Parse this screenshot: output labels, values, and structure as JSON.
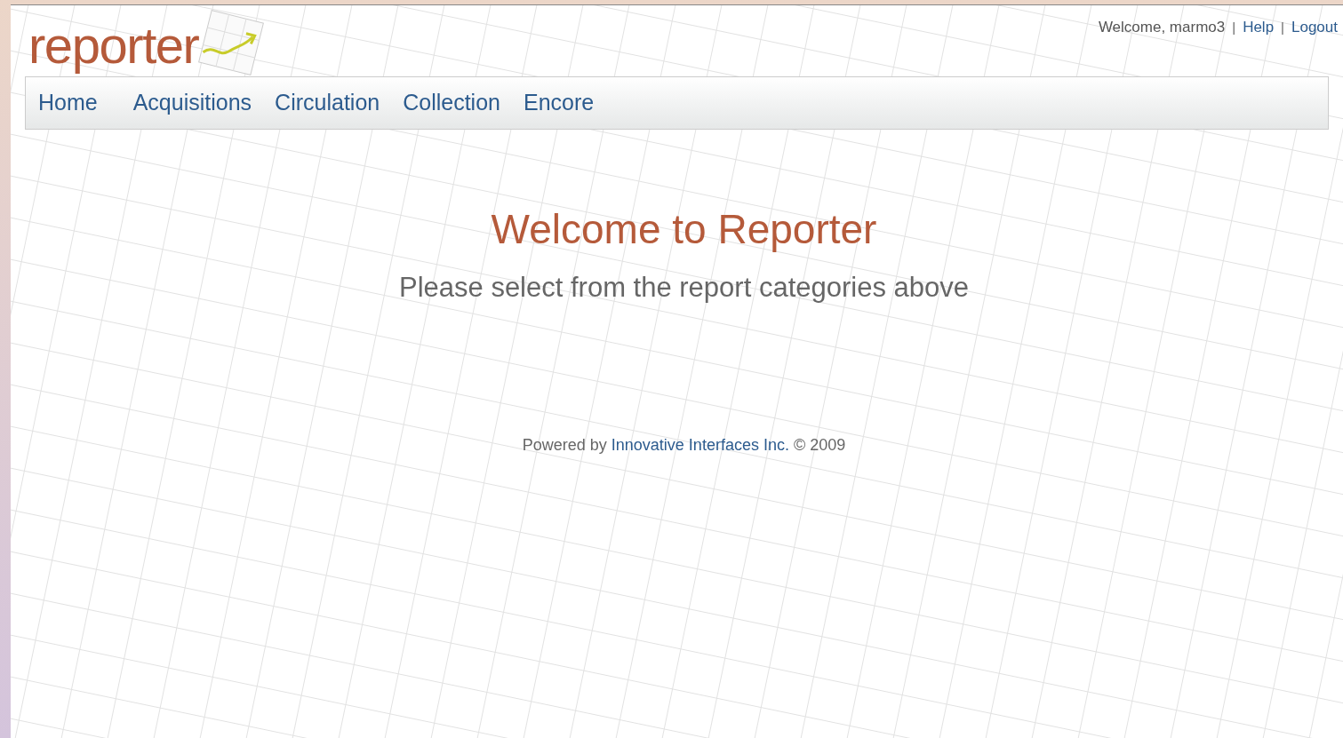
{
  "logo": {
    "text": "reporter"
  },
  "user_bar": {
    "welcome": "Welcome, marmo3",
    "links": [
      {
        "label": "Help",
        "separator": "|"
      },
      {
        "label": "Logout",
        "separator": "|"
      }
    ]
  },
  "nav": [
    {
      "label": "Home"
    },
    {
      "label": "Acquisitions"
    },
    {
      "label": "Circulation"
    },
    {
      "label": "Collection"
    },
    {
      "label": "Encore"
    }
  ],
  "heading": "Welcome to Reporter",
  "subheading": "Please select from the report categories above",
  "footer": {
    "prefix": "Powered by",
    "link": "Innovative Interfaces Inc.",
    "suffix": "© 2009"
  }
}
